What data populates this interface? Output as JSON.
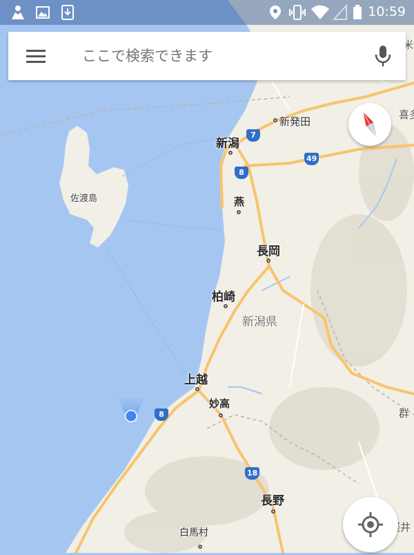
{
  "status_bar": {
    "time": "10:59",
    "left_icons": [
      "person-icon",
      "image-icon",
      "download-icon"
    ],
    "right_icons": [
      "location-pin-icon",
      "vibrate-icon",
      "wifi-icon",
      "no-signal-icon",
      "battery-icon"
    ]
  },
  "search": {
    "placeholder": "ここで検索できます",
    "menu_icon": "hamburger-menu-icon",
    "voice_icon": "microphone-icon"
  },
  "compass": {
    "icon": "compass-icon"
  },
  "my_location": {
    "icon": "my-location-icon"
  },
  "map": {
    "cities": {
      "niigata": "新潟",
      "shibata": "新発田",
      "tsubame": "燕",
      "nagaoka": "長岡",
      "kashiwazaki": "柏崎",
      "joetsu": "上越",
      "myoko": "妙高",
      "nagano": "長野",
      "hakuba": "白馬村"
    },
    "island": "佐渡島",
    "prefecture": "新潟県",
    "edge_labels": {
      "kita": "喜多",
      "gun": "群",
      "ihan": "米",
      "karui": "軽井"
    },
    "routes": {
      "r7": "7",
      "r8a": "8",
      "r8b": "8",
      "r49": "49",
      "r18": "18"
    }
  },
  "colors": {
    "sea": "#a6c6f2",
    "land": "#f1efe6",
    "highway": "#f8c46a",
    "route_shield": "#2f6fc9",
    "location_dot": "#4285f4"
  }
}
